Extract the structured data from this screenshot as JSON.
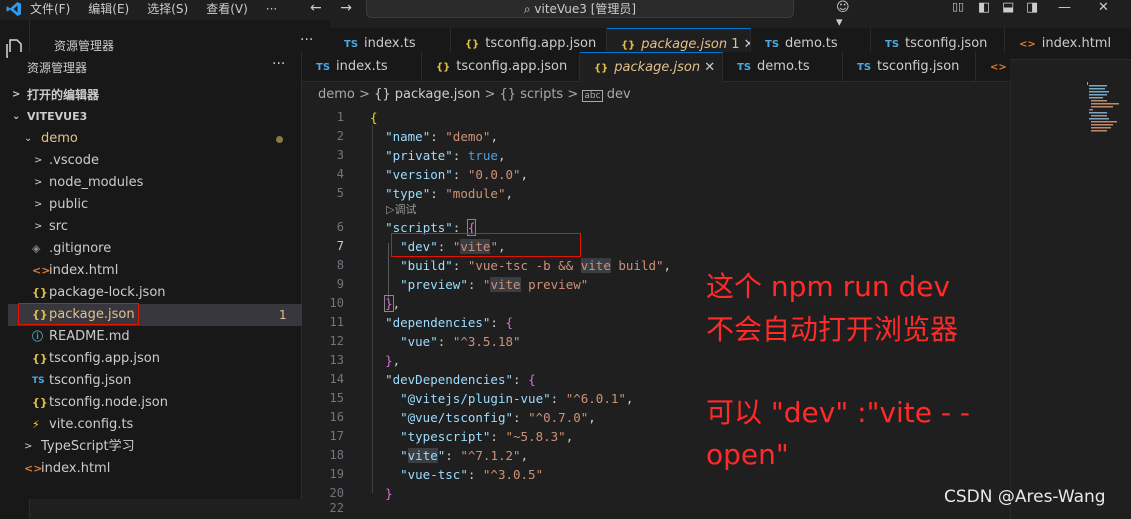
{
  "titlebar": {
    "menu": [
      "文件(F)",
      "编辑(E)",
      "选择(S)",
      "查看(V)",
      "···"
    ],
    "back": "←",
    "forward": "→",
    "search": "⌕ viteVue3 [管理员]",
    "copilot": "☺▾",
    "minimize": "—",
    "maximize": "☐",
    "close": "✕"
  },
  "outer": {
    "explorer_title": "资源管理器",
    "more": "···",
    "tabs": [
      {
        "icon": "TS",
        "label": "index.ts"
      },
      {
        "icon": "{}",
        "label": "tsconfig.app.json"
      },
      {
        "icon": "{}",
        "label": "package.json",
        "badge": "1",
        "close": "✕"
      },
      {
        "icon": "TS",
        "label": "demo.ts"
      },
      {
        "icon": "TS",
        "label": "tsconfig.json"
      },
      {
        "icon": "<>",
        "label": "index.html"
      }
    ]
  },
  "sidebar": {
    "title": "资源管理器",
    "more": "···",
    "open_editors": "打开的编辑器",
    "project": "VITEVUE3",
    "items": [
      {
        "chev": "⌄",
        "icon": "",
        "label": "demo",
        "color": "#e2c08d",
        "dot": true
      },
      {
        "chev": ">",
        "icon": "",
        "label": ".vscode"
      },
      {
        "chev": ">",
        "icon": "",
        "label": "node_modules"
      },
      {
        "chev": ">",
        "icon": "",
        "label": "public"
      },
      {
        "chev": ">",
        "icon": "",
        "label": "src"
      },
      {
        "chev": "",
        "icon": "◈",
        "label": ".gitignore"
      },
      {
        "chev": "",
        "icon": "<>",
        "label": "index.html"
      },
      {
        "chev": "",
        "icon": "{}",
        "label": "package-lock.json"
      },
      {
        "chev": "",
        "icon": "{}",
        "label": "package.json",
        "color": "#e2c08d",
        "badge": "1"
      },
      {
        "chev": "",
        "icon": "ⓘ",
        "label": "README.md"
      },
      {
        "chev": "",
        "icon": "{}",
        "label": "tsconfig.app.json"
      },
      {
        "chev": "",
        "icon": "TS",
        "label": "tsconfig.json"
      },
      {
        "chev": "",
        "icon": "{}",
        "label": "tsconfig.node.json"
      },
      {
        "chev": "",
        "icon": "⚡",
        "label": "vite.config.ts"
      },
      {
        "chev": ">",
        "icon": "",
        "label": "TypeScript学习"
      },
      {
        "chev": "",
        "icon": "<>",
        "label": "index.html"
      }
    ]
  },
  "editor": {
    "tabs": [
      {
        "icon": "TS",
        "label": "index.ts"
      },
      {
        "icon": "{}",
        "label": "tsconfig.app.json"
      },
      {
        "icon": "{}",
        "label": "package.json",
        "close": "✕"
      },
      {
        "icon": "TS",
        "label": "demo.ts"
      },
      {
        "icon": "TS",
        "label": "tsconfig.json"
      },
      {
        "icon": "<>",
        "label": "i"
      }
    ],
    "breadcrumb": [
      "demo",
      "{} package.json",
      "{} scripts",
      "dev"
    ],
    "breadcrumb_sep": ">",
    "codelens": "▷调试",
    "line_numbers": [
      "1",
      "2",
      "3",
      "4",
      "5",
      "6",
      "7",
      "8",
      "9",
      "10",
      "11",
      "12",
      "13",
      "14",
      "15",
      "16",
      "17",
      "18",
      "19",
      "20",
      "22"
    ],
    "lines": [
      "{",
      "  \"name\": \"demo\",",
      "  \"private\": true,",
      "  \"version\": \"0.0.0\",",
      "  \"type\": \"module\",",
      "  \"scripts\": {",
      "    \"dev\": \"vite\",",
      "    \"build\": \"vue-tsc -b && vite build\",",
      "    \"preview\": \"vite preview\"",
      "  },",
      "  \"dependencies\": {",
      "    \"vue\": \"^3.5.18\"",
      "  },",
      "  \"devDependencies\": {",
      "    \"@vitejs/plugin-vue\": \"^6.0.1\",",
      "    \"@vue/tsconfig\": \"^0.7.0\",",
      "    \"typescript\": \"~5.8.3\",",
      "    \"vite\": \"^7.1.2\",",
      "    \"vue-tsc\": \"^3.0.5\"",
      "  }",
      ""
    ]
  },
  "annotation": {
    "line1": "这个 npm run dev",
    "line2": "不会自动打开浏览器",
    "line3": "可以 \"dev\" :\"vite - -",
    "line4": "open\""
  },
  "watermark": "CSDN @Ares-Wang",
  "colors": {
    "accent": "#0078d4",
    "highlight_box": "#e51400",
    "annotation": "#ff2a2a"
  }
}
